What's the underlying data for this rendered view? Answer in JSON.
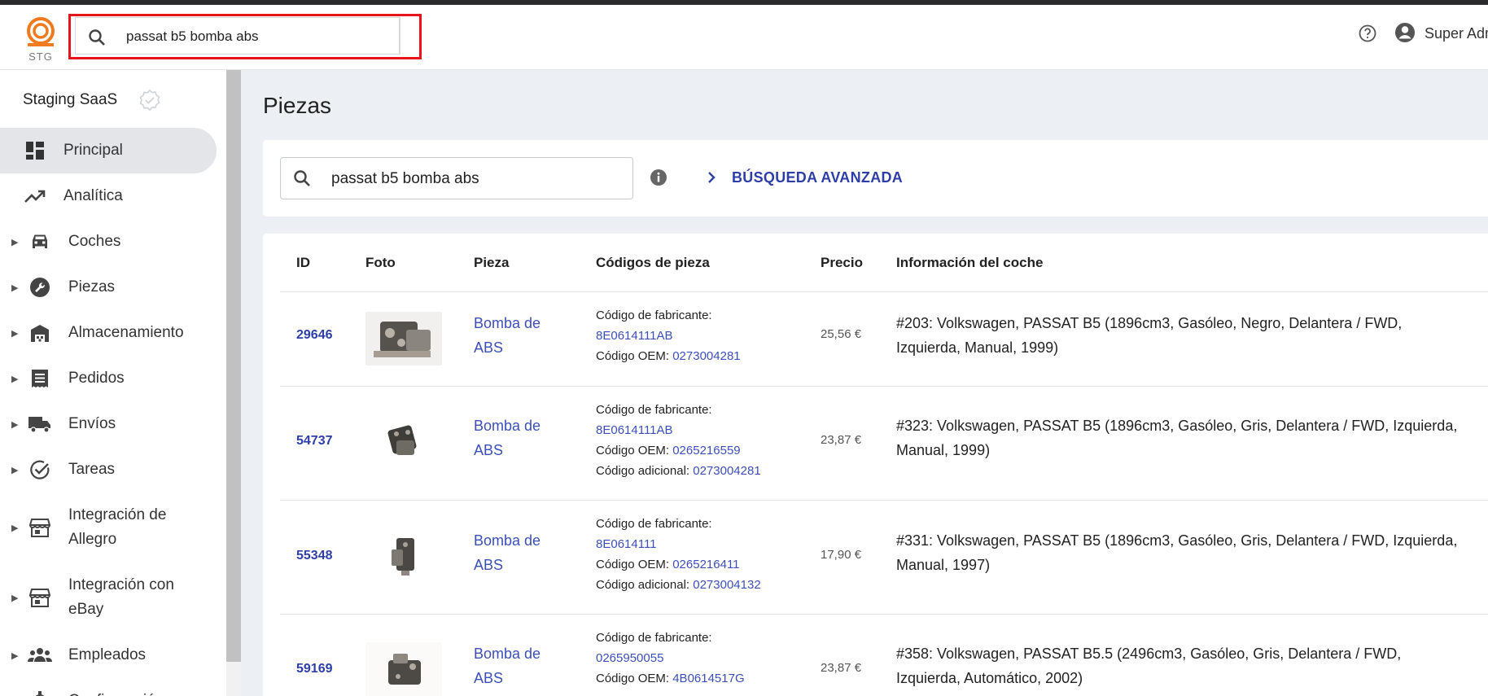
{
  "topbar": {
    "logo_text": "STG",
    "search_value": "passat b5 bomba abs",
    "user_name": "Super Admin"
  },
  "sidebar": {
    "org_name": "Staging SaaS",
    "items": [
      {
        "label": "Principal",
        "icon": "dashboard-icon",
        "active": true
      },
      {
        "label": "Analítica",
        "icon": "trending-up-icon"
      },
      {
        "label": "Coches",
        "icon": "car-icon"
      },
      {
        "label": "Piezas",
        "icon": "wrench-icon"
      },
      {
        "label": "Almacenamiento",
        "icon": "warehouse-icon"
      },
      {
        "label": "Pedidos",
        "icon": "receipt-icon"
      },
      {
        "label": "Envíos",
        "icon": "truck-icon"
      },
      {
        "label": "Tareas",
        "icon": "check-circle-icon"
      },
      {
        "label": "Integración de Allegro",
        "icon": "store-icon"
      },
      {
        "label": "Integración con eBay",
        "icon": "store-icon"
      },
      {
        "label": "Empleados",
        "icon": "people-icon"
      },
      {
        "label": "Configuración",
        "icon": "gear-icon"
      }
    ]
  },
  "main": {
    "title": "Piezas",
    "search_value": "passat b5 bomba abs",
    "advanced_search_label": "BÚSQUEDA AVANZADA"
  },
  "table": {
    "headers": [
      "ID",
      "Foto",
      "Pieza",
      "Códigos de pieza",
      "Precio",
      "Información del coche"
    ],
    "rows": [
      {
        "id": "29646",
        "pieza": "Bomba de ABS",
        "codes": [
          {
            "label": "Código de fabricante:",
            "value": "8E0614111AB"
          },
          {
            "label": "Código OEM:",
            "value": "0273004281"
          }
        ],
        "price": "25,56 €",
        "car_info": "#203: Volkswagen, PASSAT B5 (1896cm3, Gasóleo, Negro, Delantera / FWD, Izquierda, Manual, 1999)"
      },
      {
        "id": "54737",
        "pieza": "Bomba de ABS",
        "codes": [
          {
            "label": "Código de fabricante:",
            "value": "8E0614111AB"
          },
          {
            "label": "Código OEM:",
            "value": "0265216559"
          },
          {
            "label": "Código adicional:",
            "value": "0273004281"
          }
        ],
        "price": "23,87 €",
        "car_info": "#323: Volkswagen, PASSAT B5 (1896cm3, Gasóleo, Gris, Delantera / FWD, Izquierda, Manual, 1999)"
      },
      {
        "id": "55348",
        "pieza": "Bomba de ABS",
        "codes": [
          {
            "label": "Código de fabricante:",
            "value": "8E0614111"
          },
          {
            "label": "Código OEM:",
            "value": "0265216411"
          },
          {
            "label": "Código adicional:",
            "value": "0273004132"
          }
        ],
        "price": "17,90 €",
        "car_info": "#331: Volkswagen, PASSAT B5 (1896cm3, Gasóleo, Gris, Delantera / FWD, Izquierda, Manual, 1997)"
      },
      {
        "id": "59169",
        "pieza": "Bomba de ABS",
        "codes": [
          {
            "label": "Código de fabricante:",
            "value": "0265950055"
          },
          {
            "label": "Código OEM:",
            "value": "4B0614517G"
          }
        ],
        "price": "23,87 €",
        "car_info": "#358: Volkswagen, PASSAT B5.5 (2496cm3, Gasóleo, Gris, Delantera / FWD, Izquierda, Automático, 2002)"
      }
    ]
  },
  "colors": {
    "accent": "#2d3fa6",
    "logo": "#f07a1e",
    "highlight_outline": "#e8141b"
  }
}
